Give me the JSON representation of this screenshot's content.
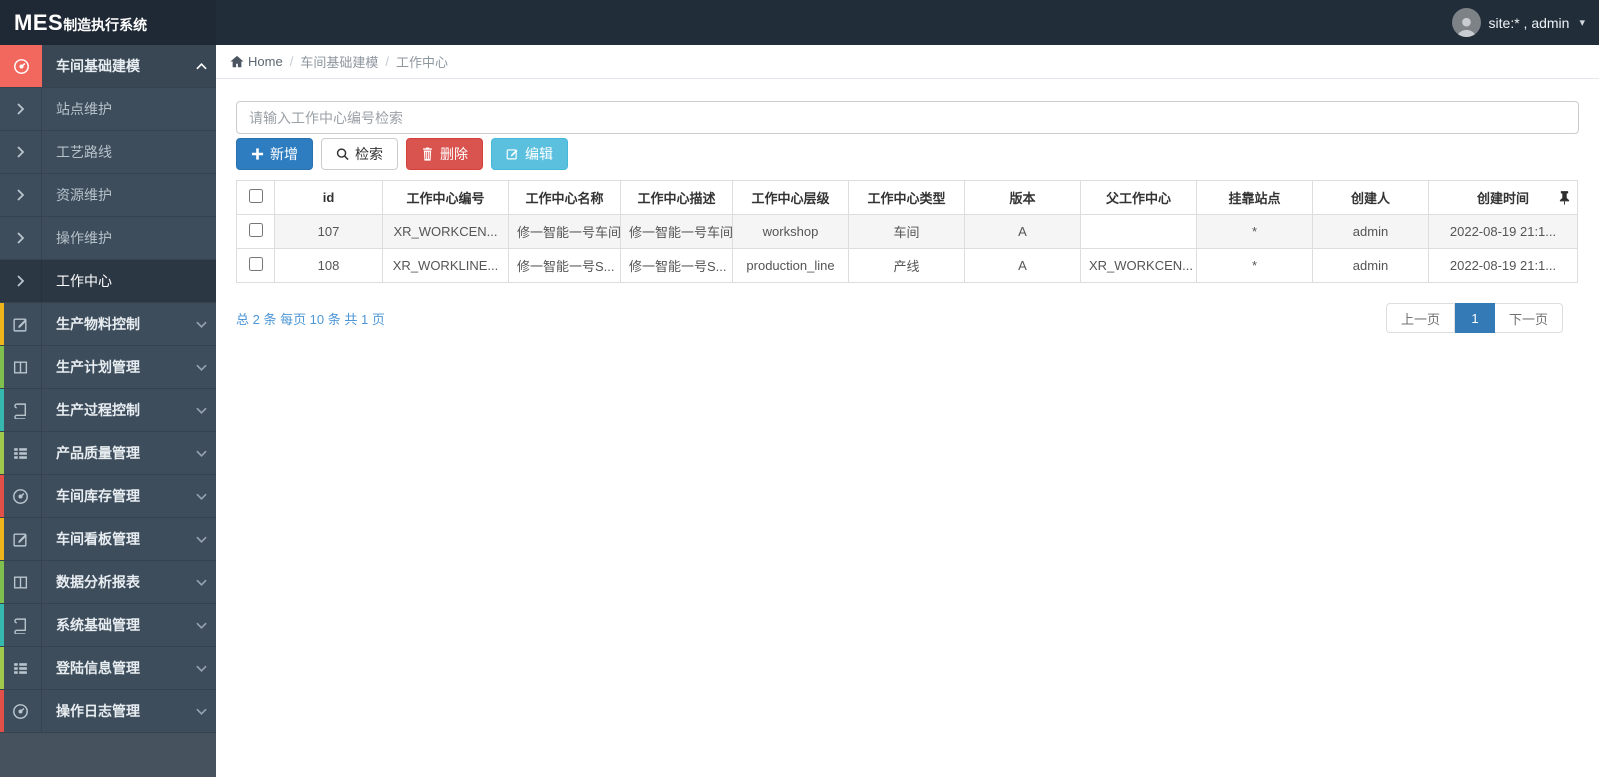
{
  "topbar": {
    "logo_main": "MES",
    "logo_sub": "制造执行系统",
    "user": "site:* , admin"
  },
  "breadcrumb": {
    "home": "Home",
    "level1": "车间基础建模",
    "level2": "工作中心",
    "separator": "/"
  },
  "sidebar": {
    "items": [
      {
        "label": "车间基础建模",
        "icon": "gauge-icon",
        "accent": "#f2685e",
        "state": "active-open",
        "children": [
          {
            "label": "站点维护",
            "active": false
          },
          {
            "label": "工艺路线",
            "active": false
          },
          {
            "label": "资源维护",
            "active": false
          },
          {
            "label": "操作维护",
            "active": false
          },
          {
            "label": "工作中心",
            "active": true
          }
        ]
      },
      {
        "label": "生产物料控制",
        "icon": "edit-icon",
        "accent": "#efb31b"
      },
      {
        "label": "生产计划管理",
        "icon": "columns-icon",
        "accent": "#7fbf4d"
      },
      {
        "label": "生产过程控制",
        "icon": "book-icon",
        "accent": "#35b8ae"
      },
      {
        "label": "产品质量管理",
        "icon": "list-icon",
        "accent": "#a0c84c"
      },
      {
        "label": "车间库存管理",
        "icon": "gauge-icon",
        "accent": "#e25049"
      },
      {
        "label": "车间看板管理",
        "icon": "edit-icon",
        "accent": "#efb31b"
      },
      {
        "label": "数据分析报表",
        "icon": "columns-icon",
        "accent": "#7fbf4d"
      },
      {
        "label": "系统基础管理",
        "icon": "book-icon",
        "accent": "#35b8ae"
      },
      {
        "label": "登陆信息管理",
        "icon": "list-icon",
        "accent": "#a0c84c"
      },
      {
        "label": "操作日志管理",
        "icon": "gauge-icon",
        "accent": "#e25049"
      }
    ]
  },
  "search": {
    "placeholder": "请输入工作中心编号检索",
    "value": ""
  },
  "toolbar": {
    "add": "新增",
    "search": "检索",
    "delete": "删除",
    "edit": "编辑"
  },
  "table": {
    "columns": [
      "id",
      "工作中心编号",
      "工作中心名称",
      "工作中心描述",
      "工作中心层级",
      "工作中心类型",
      "版本",
      "父工作中心",
      "挂靠站点",
      "创建人",
      "创建时间"
    ],
    "rows": [
      [
        "107",
        "XR_WORKCEN...",
        "修一智能一号车间",
        "修一智能一号车间",
        "workshop",
        "车间",
        "A",
        "",
        "*",
        "admin",
        "2022-08-19 21:1..."
      ],
      [
        "108",
        "XR_WORKLINE...",
        "修一智能一号S...",
        "修一智能一号S...",
        "production_line",
        "产线",
        "A",
        "XR_WORKCEN...",
        "*",
        "admin",
        "2022-08-19 21:1..."
      ]
    ]
  },
  "pagination": {
    "info": "总 2 条  每页 10 条  共 1 页",
    "prev": "上一页",
    "page": "1",
    "next": "下一页"
  },
  "icons": {
    "home": "house-icon",
    "user_caret": "caret-down-icon",
    "pin": "pushpin-icon",
    "add": "plus-icon",
    "search": "magnifier-icon",
    "delete": "trash-icon",
    "edit": "pencil-square-icon",
    "menu_parent_open": "chevron-up-icon",
    "menu_parent_closed": "chevron-down-icon",
    "menu_sub": "chevron-right-icon"
  },
  "colors": {
    "topbar_bg": "#222d3a",
    "sidebar_bg": "#3e4d5c",
    "sidebar_active_sub": "#2c3744",
    "active_icon_block": "#f2685e",
    "primary_btn": "#2f7dc1",
    "danger_btn": "#d9534f",
    "info_btn": "#5bc0de",
    "pager_active": "#337ab7",
    "link_blue": "#4d96d6",
    "stripe": "#f5f5f6"
  }
}
